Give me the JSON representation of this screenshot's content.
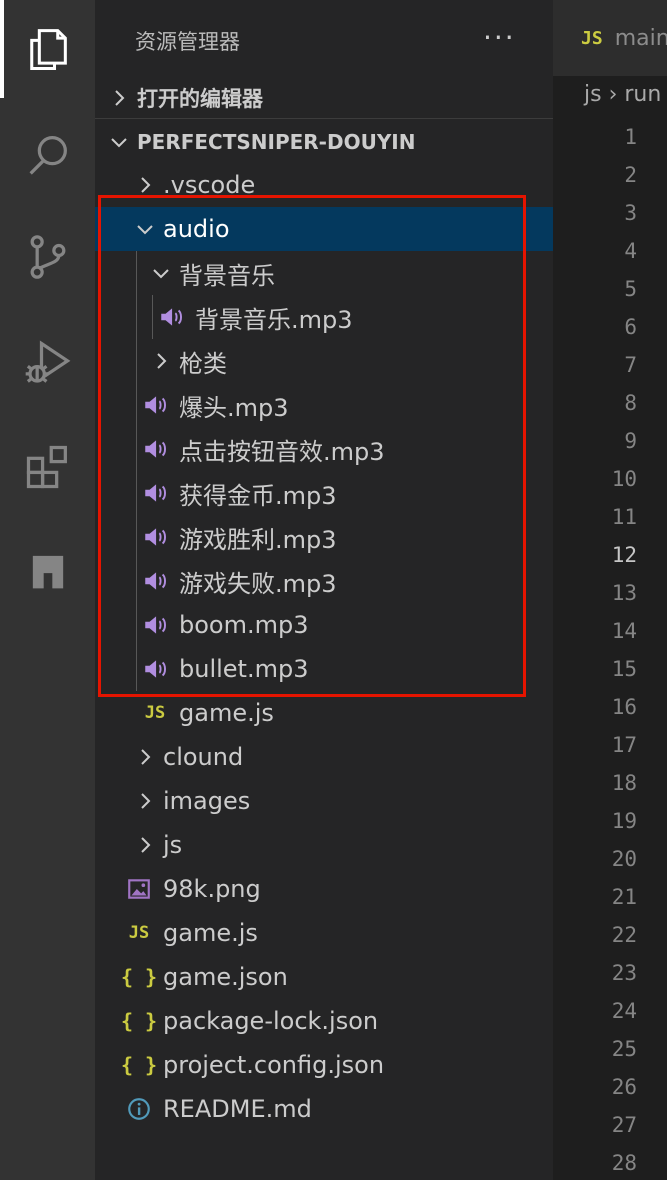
{
  "sidebar": {
    "title": "资源管理器",
    "more_actions": "···",
    "open_editors": "打开的编辑器",
    "project": "PERFECTSNIPER-DOUYIN"
  },
  "tree": {
    "vscode": ".vscode",
    "audio": "audio",
    "bgm_folder": "背景音乐",
    "bgm_file": "背景音乐.mp3",
    "guns_folder": "枪类",
    "headshot": "爆头.mp3",
    "click": "点击按钮音效.mp3",
    "coin": "获得金币.mp3",
    "win": "游戏胜利.mp3",
    "lose": "游戏失败.mp3",
    "boom": "boom.mp3",
    "bullet": "bullet.mp3",
    "audio_game_js": "game.js",
    "clound": "clound",
    "images": "images",
    "js": "js",
    "png_98k": "98k.png",
    "game_js": "game.js",
    "game_json": "game.json",
    "package_lock": "package-lock.json",
    "project_config": "project.config.json",
    "readme": "README.md"
  },
  "icons": {
    "js": "JS",
    "json": "{ }"
  },
  "editor": {
    "tab_label": "main",
    "breadcrumb": "js › run",
    "line_numbers": [
      "1",
      "2",
      "3",
      "4",
      "5",
      "6",
      "7",
      "8",
      "9",
      "10",
      "11",
      "12",
      "13",
      "14",
      "15",
      "16",
      "17",
      "18",
      "19",
      "20",
      "21",
      "22",
      "23",
      "24",
      "25",
      "26",
      "27",
      "28"
    ],
    "current_line": "12"
  },
  "colors": {
    "selection": "#04395e",
    "highlight_box": "#e51400",
    "audio_icon": "#b18ee0",
    "js_icon": "#cbcb41",
    "info_icon": "#519aba"
  }
}
